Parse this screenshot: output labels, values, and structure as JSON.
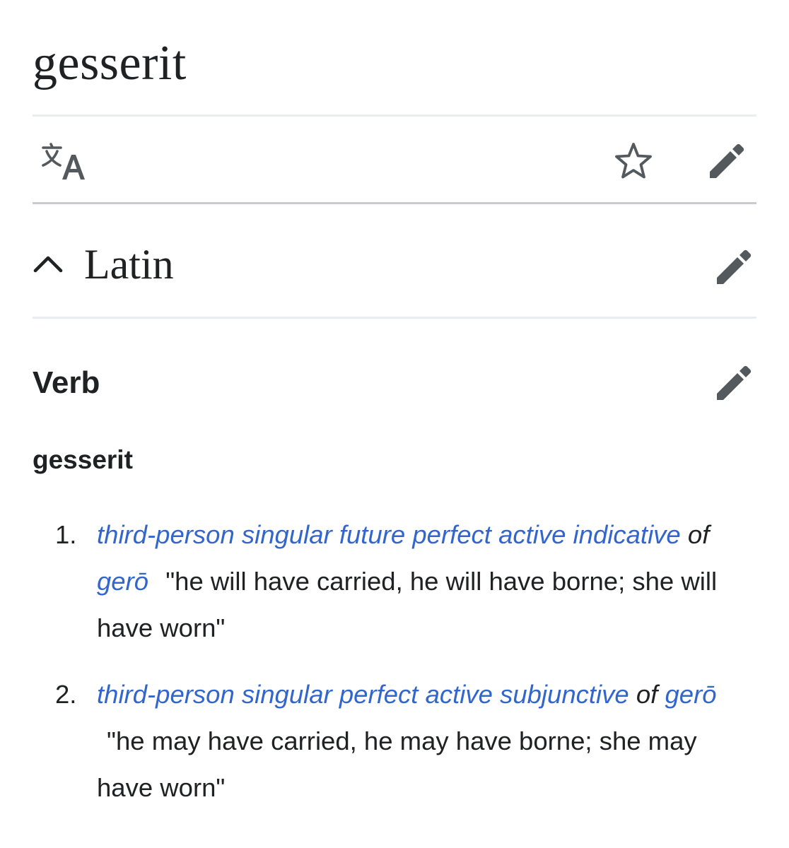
{
  "page": {
    "title": "gesserit"
  },
  "toolbar": {
    "language_icon": "translate-icon",
    "watch_icon": "star-icon",
    "edit_icon": "pencil-icon"
  },
  "section": {
    "title": "Latin",
    "collapse_icon": "chevron-up-icon",
    "edit_icon": "pencil-icon"
  },
  "subsection": {
    "title": "Verb",
    "edit_icon": "pencil-icon",
    "headword": "gesserit",
    "definitions": [
      {
        "number": "1.",
        "form_link": "third-person singular future perfect active indicative",
        "of": "of",
        "lemma_link": "gerō",
        "gloss": "\"he will have carried, he will have borne; she will have worn\""
      },
      {
        "number": "2.",
        "form_link": "third-person singular perfect active subjunctive",
        "of": "of",
        "lemma_link": "gerō",
        "gloss": "\"he may have carried, he may have borne; she may have worn\""
      }
    ]
  },
  "colors": {
    "text": "#202122",
    "link": "#3366cc",
    "icon": "#54595d",
    "divider_light": "#eaecf0",
    "divider_dark": "#c8ccd1"
  }
}
